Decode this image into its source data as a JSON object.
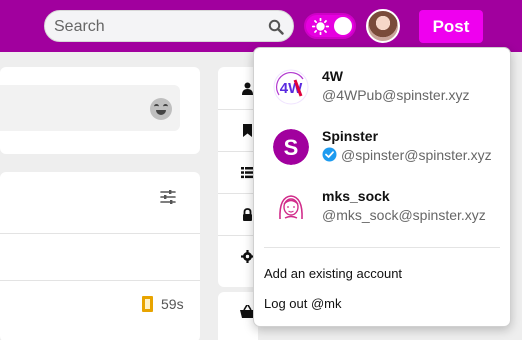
{
  "header": {
    "search_placeholder": "Search",
    "post_label": "Post",
    "accent_color": "#a1009e",
    "button_color": "#ef00ef"
  },
  "accounts": [
    {
      "name": "4W",
      "handle": "@4WPub@spinster.xyz",
      "verified": false,
      "avatar_icon": "4w-logo-icon"
    },
    {
      "name": "Spinster",
      "handle": "@spinster@spinster.xyz",
      "verified": true,
      "avatar_icon": "spinster-logo-icon"
    },
    {
      "name": "mks_sock",
      "handle": "@mks_sock@spinster.xyz",
      "verified": false,
      "avatar_icon": "cartoon-woman-avatar-icon"
    }
  ],
  "menu": {
    "add_account": "Add an existing account",
    "logout": "Log out @mk"
  },
  "feed": {
    "time_ago": "59s"
  }
}
